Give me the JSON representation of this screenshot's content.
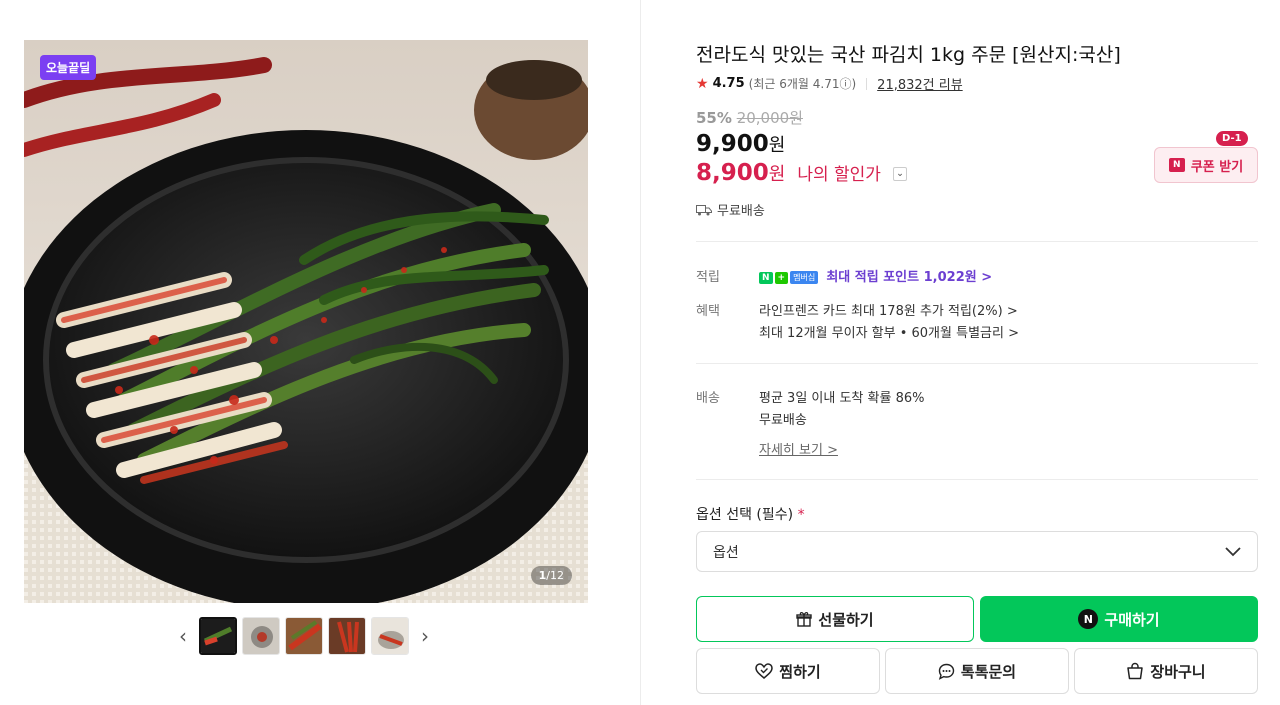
{
  "gallery": {
    "badge": "오늘끝딜",
    "counter_current": "1",
    "counter_total": "/12",
    "prev_icon": "chevron-left-icon",
    "next_icon": "chevron-right-icon"
  },
  "product": {
    "title": "전라도식 맛있는 국산 파김치 1kg 주문 [원산지:국산]",
    "rating": "4.75",
    "recent_rating": "(최근 6개월 4.71",
    "reviews": "21,832건 리뷰",
    "discount_pct": "55%",
    "original_price": "20,000원",
    "price": "9,900",
    "price_unit": "원",
    "my_price": "8,900",
    "my_price_unit": "원",
    "my_price_label": "나의 할인가",
    "free_shipping": "무료배송"
  },
  "coupon": {
    "dday": "D-1",
    "icon": "N",
    "label": "쿠폰 받기"
  },
  "benefits": {
    "points_label": "적립",
    "npay_n": "N",
    "npay_plus": "+",
    "npay_member": "멤버십",
    "points_text": "최대 적립 포인트 1,022원 >",
    "benefit_label": "혜택",
    "card_text": "라인프렌즈 카드 최대 178원 추가 적립(2%) >",
    "installment_text": "최대 12개월 무이자 할부 • 60개월 특별금리 >"
  },
  "delivery": {
    "label": "배송",
    "arrival": "평균 3일 이내 도착 확률 86%",
    "free": "무료배송",
    "more": "자세히 보기 >"
  },
  "option": {
    "title": "옵션 선택 (필수)",
    "required_mark": "*",
    "placeholder": "옵션"
  },
  "actions": {
    "gift": "선물하기",
    "buy_badge": "N",
    "buy": "구매하기",
    "wish": "찜하기",
    "inquiry": "톡톡문의",
    "cart": "장바구니"
  },
  "colors": {
    "accent_green": "#03c75a",
    "price_red": "#d6204e",
    "badge_purple": "#7b3ff2"
  }
}
